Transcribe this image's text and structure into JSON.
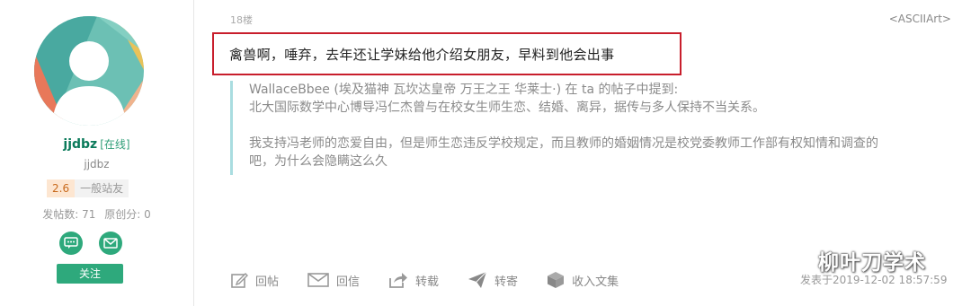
{
  "user": {
    "username": "jjdbz",
    "online_status": "[在线]",
    "sub_name": "jjdbz",
    "score": "2.6",
    "rank": "一般站友",
    "posts_label": "发帖数: 71",
    "original_label": "原创分: 0",
    "follow_label": "关注"
  },
  "post": {
    "floor": "18楼",
    "ascii_tag": "<ASCIIArt>",
    "text": "禽兽啊，唾弃，去年还让学妹给他介绍女朋友，早料到他会出事",
    "quote": {
      "head": "WallaceBbee (埃及猫神 瓦坎达皇帝 万王之王 华莱士·) 在 ta 的帖子中提到:",
      "body": "北大国际数学中心博导冯仁杰曾与在校女生师生恋、结婚、离异，据传与多人保持不当关系。",
      "reply_line1": "我支持冯老师的恋爱自由，但是师生恋违反学校规定，而且教师的婚姻情况是校党委教师工作部有权知情和调查的",
      "reply_line2": "吧，为什么会隐瞒这么久"
    },
    "timestamp": "发表于2019-12-02 18:57:59"
  },
  "toolbar": {
    "reply_post": "回帖",
    "reply_mail": "回信",
    "forward": "转载",
    "send": "转寄",
    "collect": "收入文集"
  },
  "watermark": {
    "text": "柳叶刀学术"
  },
  "colors": {
    "accent_green": "#2ea97c",
    "highlight_red": "#c81e2c",
    "quote_bar": "#a9dde0"
  }
}
